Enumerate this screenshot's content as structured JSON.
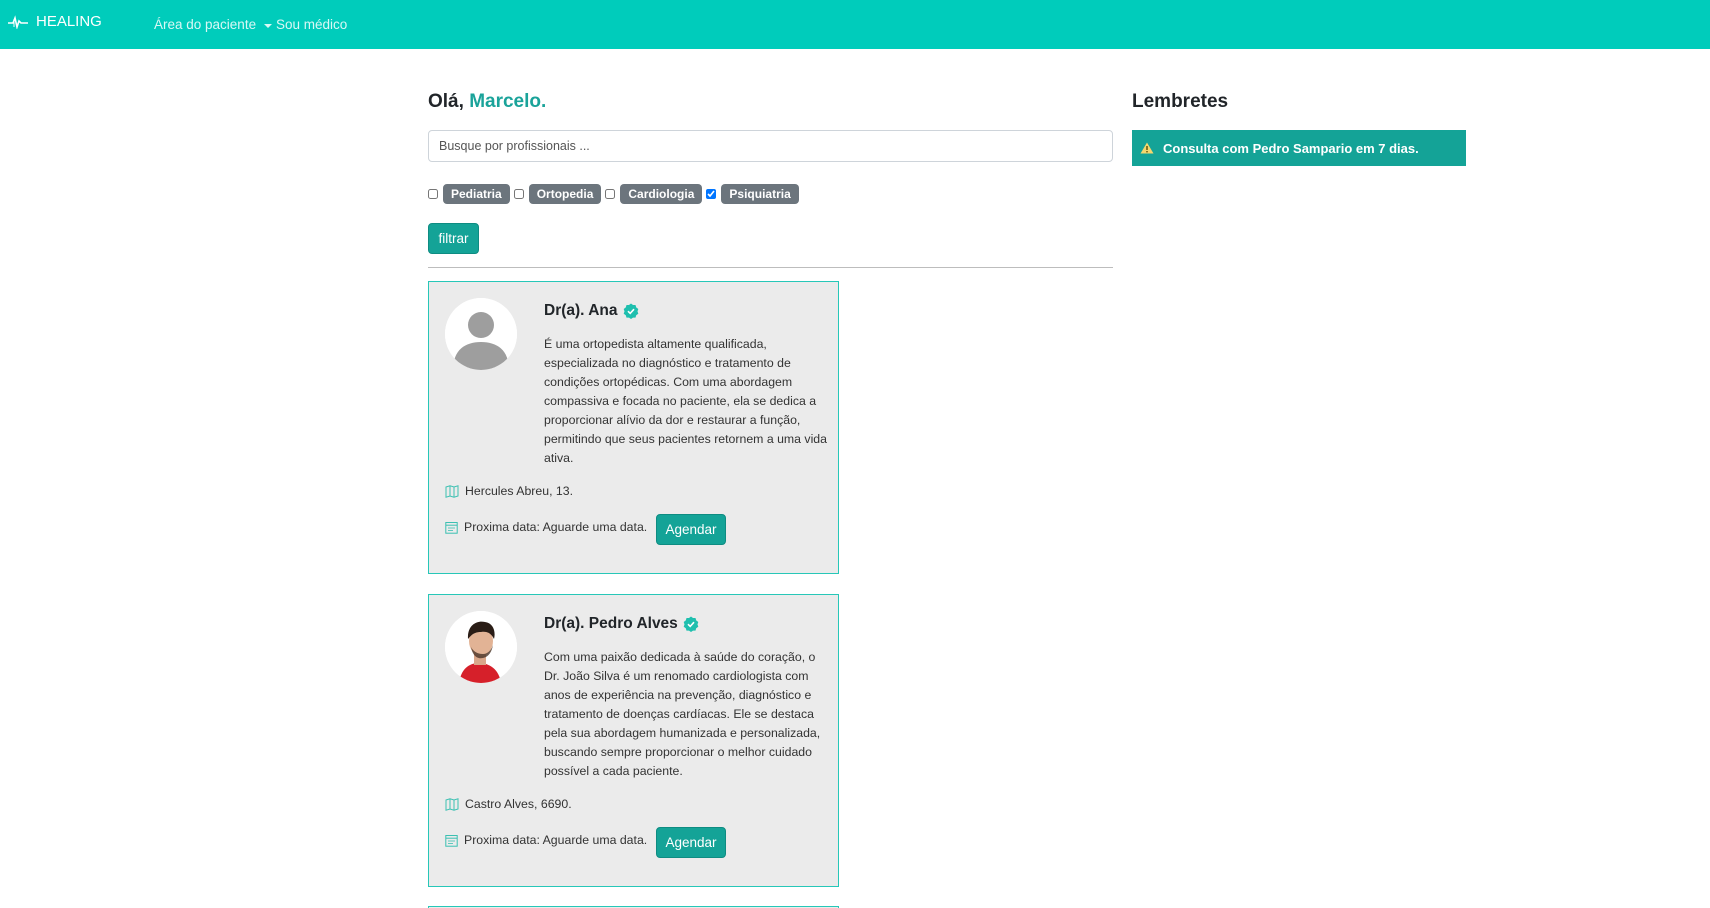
{
  "navbar": {
    "brand": "HEALING",
    "items": [
      {
        "label": "Área do paciente",
        "dropdown": true
      },
      {
        "label": "Sou médico"
      }
    ]
  },
  "main": {
    "greeting_prefix": "Olá,",
    "user_name": "Marcelo.",
    "search_placeholder": "Busque por profissionais ...",
    "filters": [
      {
        "label": "Pediatria",
        "checked": false
      },
      {
        "label": "Ortopedia",
        "checked": false
      },
      {
        "label": "Cardiologia",
        "checked": false
      },
      {
        "label": "Psiquiatria",
        "checked": true
      }
    ],
    "filter_button": "filtrar",
    "doctors": [
      {
        "name": "Dr(a). Ana",
        "verified": true,
        "description": "É uma ortopedista altamente qualificada, especializada no diagnóstico e tratamento de condições ortopédicas. Com uma abordagem compassiva e focada no paciente, ela se dedica a proporcionar alívio da dor e restaurar a função, permitindo que seus pacientes retornem a uma vida ativa.",
        "address": "Hercules Abreu, 13.",
        "next_date": "Proxima data: Aguarde uma data.",
        "button": "Agendar"
      },
      {
        "name": "Dr(a). Pedro Alves",
        "verified": true,
        "description": "Com uma paixão dedicada à saúde do coração, o Dr. João Silva é um renomado cardiologista com anos de experiência na prevenção, diagnóstico e tratamento de doenças cardíacas. Ele se destaca pela sua abordagem humanizada e personalizada, buscando sempre proporcionar o melhor cuidado possível a cada paciente.",
        "address": "Castro Alves, 6690.",
        "next_date": "Proxima data: Aguarde uma data.",
        "button": "Agendar"
      }
    ]
  },
  "sidebar": {
    "title": "Lembretes",
    "reminders": [
      "Consulta com Pedro Sampario em 7 dias."
    ]
  },
  "colors": {
    "navbar": "#00ccbb",
    "accent": "#14a397",
    "card_bg": "#ebebeb",
    "badge": "#6c757d"
  }
}
